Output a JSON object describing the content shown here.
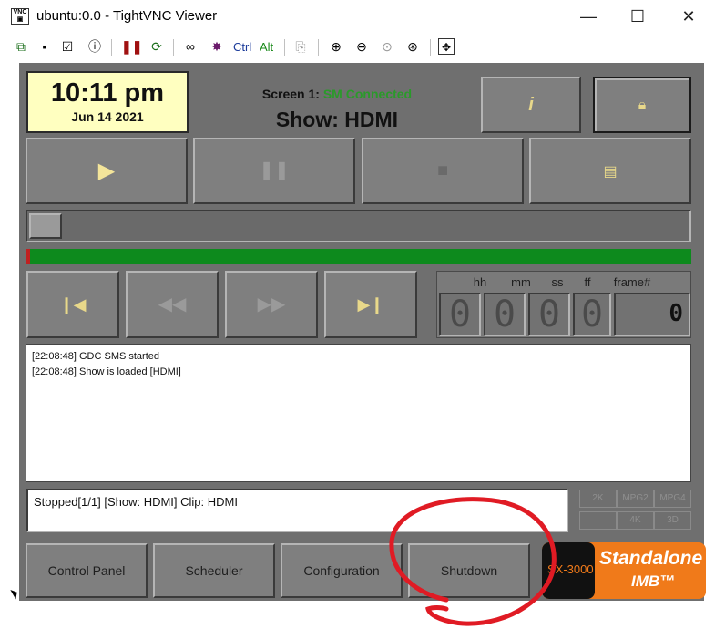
{
  "window": {
    "title": "ubuntu:0.0 - TightVNC Viewer",
    "minimize_glyph": "—",
    "maximize_glyph": "☐",
    "close_glyph": "✕",
    "app_icon": "vnc-icon"
  },
  "toolbar": {
    "ctrl_label": "Ctrl",
    "alt_label": "Alt"
  },
  "clock": {
    "time": "10:11 pm",
    "date": "Jun 14 2021"
  },
  "screen": {
    "label": "Screen 1:",
    "status": "SM Connected",
    "show": "Show: HDMI"
  },
  "timecode": {
    "headers": [
      "hh",
      "mm",
      "ss",
      "ff",
      "frame#"
    ],
    "digits": [
      "0",
      "0",
      "0",
      "0"
    ],
    "frame": "0"
  },
  "log": {
    "lines": [
      "[22:08:48] GDC SMS started",
      "[22:08:48] Show is loaded [HDMI]"
    ]
  },
  "status": {
    "text": "Stopped[1/1] [Show: HDMI] Clip: HDMI"
  },
  "formats": [
    "2K",
    "MPG2",
    "MPG4",
    "",
    "4K",
    "3D"
  ],
  "nav": {
    "control_panel": "Control Panel",
    "scheduler": "Scheduler",
    "configuration": "Configuration",
    "shutdown": "Shutdown"
  },
  "brand": {
    "model": "SX-3000",
    "name": "Standalone",
    "sub": "IMB™"
  },
  "colors": {
    "accent_green": "#2a9a2a",
    "progress_bar": "#0d8a1d",
    "annotation_red": "#e01b24",
    "clock_bg": "#ffffc0",
    "brand_orange": "#f07a1a"
  }
}
